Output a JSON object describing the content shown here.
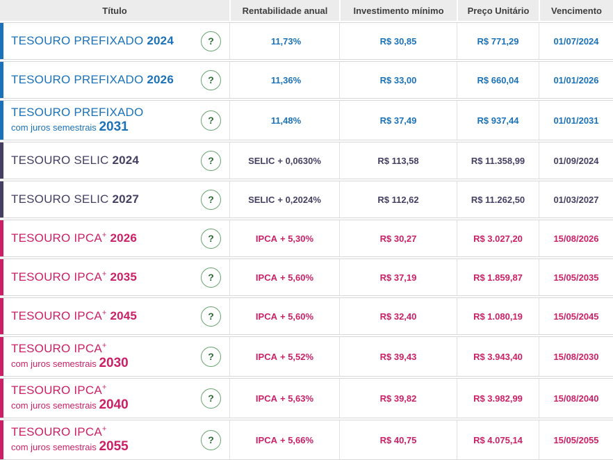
{
  "table": {
    "columns": [
      {
        "label": "Título"
      },
      {
        "label": "Rentabilidade anual"
      },
      {
        "label": "Investimento mínimo"
      },
      {
        "label": "Preço Unitário"
      },
      {
        "label": "Vencimento"
      }
    ]
  },
  "colors": {
    "prefixado": "#1b72b8",
    "selic": "#453f63",
    "ipca": "#cb2066",
    "header_bg": "#ececec",
    "header_text": "#3e3e3e",
    "row_border": "#d7d7d7",
    "help_border": "#6aa570",
    "help_text": "#2d6b35"
  },
  "help_icon_glyph": "?",
  "rows": [
    {
      "group": "prefixado",
      "title": "TESOURO PREFIXADO",
      "plus": "",
      "subtitle": "",
      "year": "2024",
      "rent_label": "",
      "rent_value": "11,73%",
      "min_investment": "R$ 30,85",
      "unit_price": "R$ 771,29",
      "maturity": "01/07/2024"
    },
    {
      "group": "prefixado",
      "title": "TESOURO PREFIXADO",
      "plus": "",
      "subtitle": "",
      "year": "2026",
      "rent_label": "",
      "rent_value": "11,36%",
      "min_investment": "R$ 33,00",
      "unit_price": "R$ 660,04",
      "maturity": "01/01/2026"
    },
    {
      "group": "prefixado",
      "title": "TESOURO PREFIXADO",
      "plus": "",
      "subtitle": "com juros semestrais",
      "year": "2031",
      "rent_label": "",
      "rent_value": "11,48%",
      "min_investment": "R$ 37,49",
      "unit_price": "R$ 937,44",
      "maturity": "01/01/2031"
    },
    {
      "group": "selic",
      "title": "TESOURO SELIC",
      "plus": "",
      "subtitle": "",
      "year": "2024",
      "rent_label": "SELIC",
      "rent_value": "+ 0,0630%",
      "min_investment": "R$ 113,58",
      "unit_price": "R$ 11.358,99",
      "maturity": "01/09/2024"
    },
    {
      "group": "selic",
      "title": "TESOURO SELIC",
      "plus": "",
      "subtitle": "",
      "year": "2027",
      "rent_label": "SELIC",
      "rent_value": "+ 0,2024%",
      "min_investment": "R$ 112,62",
      "unit_price": "R$ 11.262,50",
      "maturity": "01/03/2027"
    },
    {
      "group": "ipca",
      "title": "TESOURO IPCA",
      "plus": "+",
      "subtitle": "",
      "year": "2026",
      "rent_label": "IPCA",
      "rent_value": "+ 5,30%",
      "min_investment": "R$ 30,27",
      "unit_price": "R$ 3.027,20",
      "maturity": "15/08/2026"
    },
    {
      "group": "ipca",
      "title": "TESOURO IPCA",
      "plus": "+",
      "subtitle": "",
      "year": "2035",
      "rent_label": "IPCA",
      "rent_value": "+ 5,60%",
      "min_investment": "R$ 37,19",
      "unit_price": "R$ 1.859,87",
      "maturity": "15/05/2035"
    },
    {
      "group": "ipca",
      "title": "TESOURO IPCA",
      "plus": "+",
      "subtitle": "",
      "year": "2045",
      "rent_label": "IPCA",
      "rent_value": "+ 5,60%",
      "min_investment": "R$ 32,40",
      "unit_price": "R$ 1.080,19",
      "maturity": "15/05/2045"
    },
    {
      "group": "ipca",
      "title": "TESOURO IPCA",
      "plus": "+",
      "subtitle": "com juros semestrais",
      "year": "2030",
      "rent_label": "IPCA",
      "rent_value": "+ 5,52%",
      "min_investment": "R$ 39,43",
      "unit_price": "R$ 3.943,40",
      "maturity": "15/08/2030"
    },
    {
      "group": "ipca",
      "title": "TESOURO IPCA",
      "plus": "+",
      "subtitle": "com juros semestrais",
      "year": "2040",
      "rent_label": "IPCA",
      "rent_value": "+ 5,63%",
      "min_investment": "R$ 39,82",
      "unit_price": "R$ 3.982,99",
      "maturity": "15/08/2040"
    },
    {
      "group": "ipca",
      "title": "TESOURO IPCA",
      "plus": "+",
      "subtitle": "com juros semestrais",
      "year": "2055",
      "rent_label": "IPCA",
      "rent_value": "+ 5,66%",
      "min_investment": "R$ 40,75",
      "unit_price": "R$ 4.075,14",
      "maturity": "15/05/2055"
    }
  ]
}
